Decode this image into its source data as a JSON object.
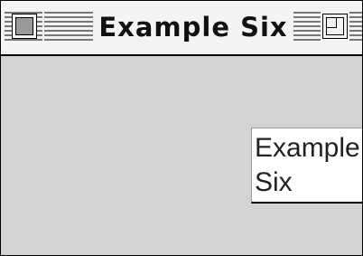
{
  "window": {
    "title": "Example Six"
  },
  "content": {
    "label_line1": "Example",
    "label_line2": "Six"
  },
  "colors": {
    "desktop": "#d3d3d3",
    "titlebar": "#f4f4f4",
    "label_bg": "#ffffff"
  }
}
